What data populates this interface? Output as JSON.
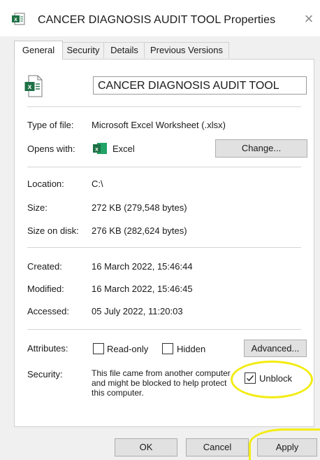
{
  "window": {
    "title": "CANCER DIAGNOSIS AUDIT TOOL  Properties",
    "close_glyph": "×",
    "title_icon": "excel-file-icon"
  },
  "tabs": [
    {
      "label": "General",
      "active": true
    },
    {
      "label": "Security",
      "active": false
    },
    {
      "label": "Details",
      "active": false
    },
    {
      "label": "Previous Versions",
      "active": false
    }
  ],
  "file": {
    "name": "CANCER DIAGNOSIS AUDIT TOOL",
    "icon": "excel-worksheet-icon"
  },
  "props": {
    "type_label": "Type of file:",
    "type_value": "Microsoft Excel Worksheet (.xlsx)",
    "opens_label": "Opens with:",
    "opens_value": "Excel",
    "opens_icon": "excel-app-icon",
    "change_button": "Change...",
    "location_label": "Location:",
    "location_value": "C:\\",
    "size_label": "Size:",
    "size_value": "272 KB (279,548 bytes)",
    "size_disk_label": "Size on disk:",
    "size_disk_value": "276 KB (282,624 bytes)",
    "created_label": "Created:",
    "created_value": "16 March 2022, 15:46:44",
    "modified_label": "Modified:",
    "modified_value": "16 March 2022, 15:46:45",
    "accessed_label": "Accessed:",
    "accessed_value": "05 July 2022, 11:20:03",
    "attributes_label": "Attributes:",
    "readonly_label": "Read-only",
    "readonly_checked": false,
    "hidden_label": "Hidden",
    "hidden_checked": false,
    "advanced_button": "Advanced...",
    "security_label": "Security:",
    "security_text": "This file came from another computer and might be blocked to help protect this computer.",
    "unblock_label": "Unblock",
    "unblock_checked": true
  },
  "footer": {
    "ok": "OK",
    "cancel": "Cancel",
    "apply": "Apply"
  },
  "colors": {
    "annotation": "#f3ec12",
    "excel_green": "#1e7145"
  }
}
